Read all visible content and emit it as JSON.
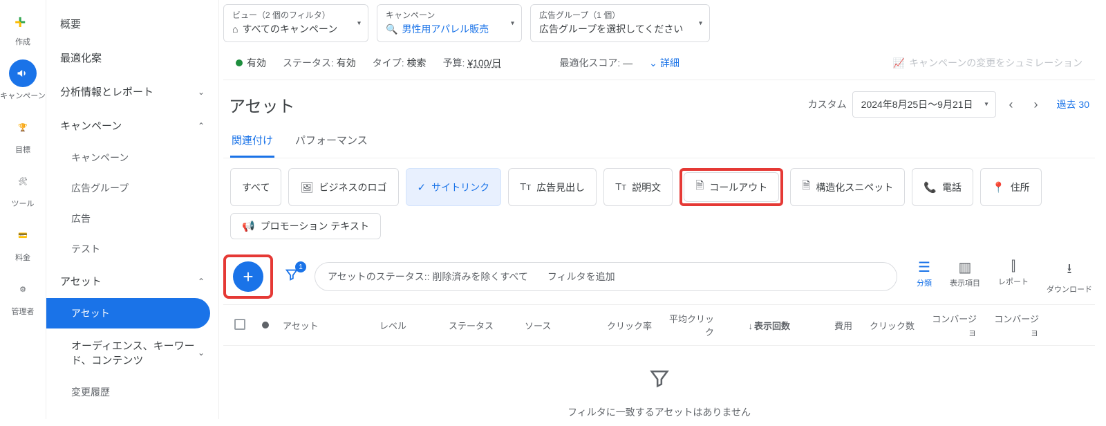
{
  "rail": {
    "create": "作成",
    "campaigns": "キャンペーン",
    "goals": "目標",
    "tools": "ツール",
    "billing": "料金",
    "admin": "管理者"
  },
  "sidebar": {
    "overview": "概要",
    "recommendations": "最適化案",
    "insights": "分析情報とレポート",
    "campaigns_group": "キャンペーン",
    "sub_campaigns": "キャンペーン",
    "sub_adgroups": "広告グループ",
    "sub_ads": "広告",
    "sub_tests": "テスト",
    "assets_group": "アセット",
    "sub_assets": "アセット",
    "sub_audiences": "オーディエンス、キーワード、コンテンツ",
    "sub_history": "変更履歴"
  },
  "crumbs": {
    "view_label": "ビュー（2 個のフィルタ）",
    "view_value": "すべてのキャンペーン",
    "campaign_label": "キャンペーン",
    "campaign_value": "男性用アパレル販売",
    "adgroup_label": "広告グループ（1 個）",
    "adgroup_value": "広告グループを選択してください"
  },
  "summary": {
    "status_value": "有効",
    "status_key": "ステータス:",
    "status_val": "有効",
    "type_key": "タイプ:",
    "type_val": "検索",
    "budget_key": "予算:",
    "budget_val": "¥100/日",
    "score_key": "最適化スコア:",
    "score_val": "—",
    "details": "詳細",
    "simulate": "キャンペーンの変更をシュミレーション"
  },
  "title": "アセット",
  "date": {
    "prefix": "カスタム",
    "range": "2024年8月25日～9月21日",
    "past30": "過去 30"
  },
  "tabs": {
    "assoc": "関連付け",
    "perf": "パフォーマンス"
  },
  "chips": {
    "all": "すべて",
    "logo": "ビジネスのロゴ",
    "sitelink": "サイトリンク",
    "headline": "広告見出し",
    "description": "説明文",
    "callout": "コールアウト",
    "snippet": "構造化スニペット",
    "phone": "電話",
    "location": "住所",
    "promo": "プロモーション テキスト"
  },
  "filter": {
    "badge": "1",
    "status_chip": "アセットのステータス:: 削除済みを除くすべて",
    "add": "フィルタを追加"
  },
  "ticons": {
    "segment": "分類",
    "columns": "表示項目",
    "report": "レポート",
    "download": "ダウンロード"
  },
  "cols": {
    "asset": "アセット",
    "level": "レベル",
    "status": "ステータス",
    "source": "ソース",
    "ctr": "クリック率",
    "avg_click": "平均クリック",
    "impressions": "表示回数",
    "cost": "費用",
    "clicks": "クリック数",
    "conv1": "コンバージョ",
    "conv2": "コンバージョ"
  },
  "sort_arrow": "↓",
  "empty": "フィルタに一致するアセットはありません"
}
